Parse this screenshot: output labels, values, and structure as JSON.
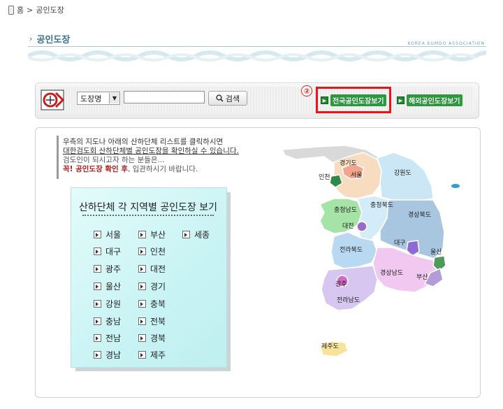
{
  "breadcrumb": {
    "home": "홈",
    "separator": ">",
    "current": "공인도장"
  },
  "page": {
    "title": "공인도장",
    "org_text": "KOREA KUMDO ASSOCIATION"
  },
  "search": {
    "select_value": "도장명",
    "input_value": "",
    "button_label": "검색",
    "marker_number": "②",
    "national_button": "전국공인도장보기",
    "overseas_button": "해외공인도장보기"
  },
  "intro": {
    "line1": "우측의 지도나 아래의 산하단체 리스트를 클릭하시면",
    "line2": "대한검도회 산하단체별 공인도장을 확인하실 수 있습니다.",
    "line3": "검도인이 되시고자 하는 분들은...",
    "line4_emphasis": "꼭! 공인도장 확인 후",
    "line4_rest": ", 입관하시기 바랍니다."
  },
  "regions": {
    "title": "산하단체 각 지역별 공인도장 보기",
    "items": [
      "서울",
      "부산",
      "세종",
      "대구",
      "인천",
      "광주",
      "대전",
      "울산",
      "경기",
      "강원",
      "충북",
      "충남",
      "전북",
      "전남",
      "경북",
      "경남",
      "제주"
    ]
  },
  "map": {
    "labels": [
      "경기도",
      "인천",
      "서울",
      "강원도",
      "충청남도",
      "충청북도",
      "대전",
      "경상북도",
      "전라북도",
      "대구",
      "울산",
      "경상남도",
      "부산",
      "광주",
      "전라남도",
      "제주도"
    ],
    "colors": {
      "gyeonggi": "#f7dcc0",
      "seoul": "#f2a48c",
      "incheon": "#2f8a47",
      "gangwon": "#cbe7f5",
      "chungnam": "#a6e3a6",
      "chungbuk": "#d4ecf7",
      "daejeon": "#9a6cc8",
      "gyeongbuk": "#a9c6e0",
      "jeonbuk": "#b9d8f1",
      "daegu": "#8f6ad6",
      "ulsan": "#4d9a5a",
      "gyeongnam": "#f0c8f0",
      "busan": "#b49cd8",
      "gwangju": "#d268c8",
      "jeonnam": "#d6c6f0",
      "jeju": "#f7e49a",
      "north": "#d9d9d9"
    }
  }
}
